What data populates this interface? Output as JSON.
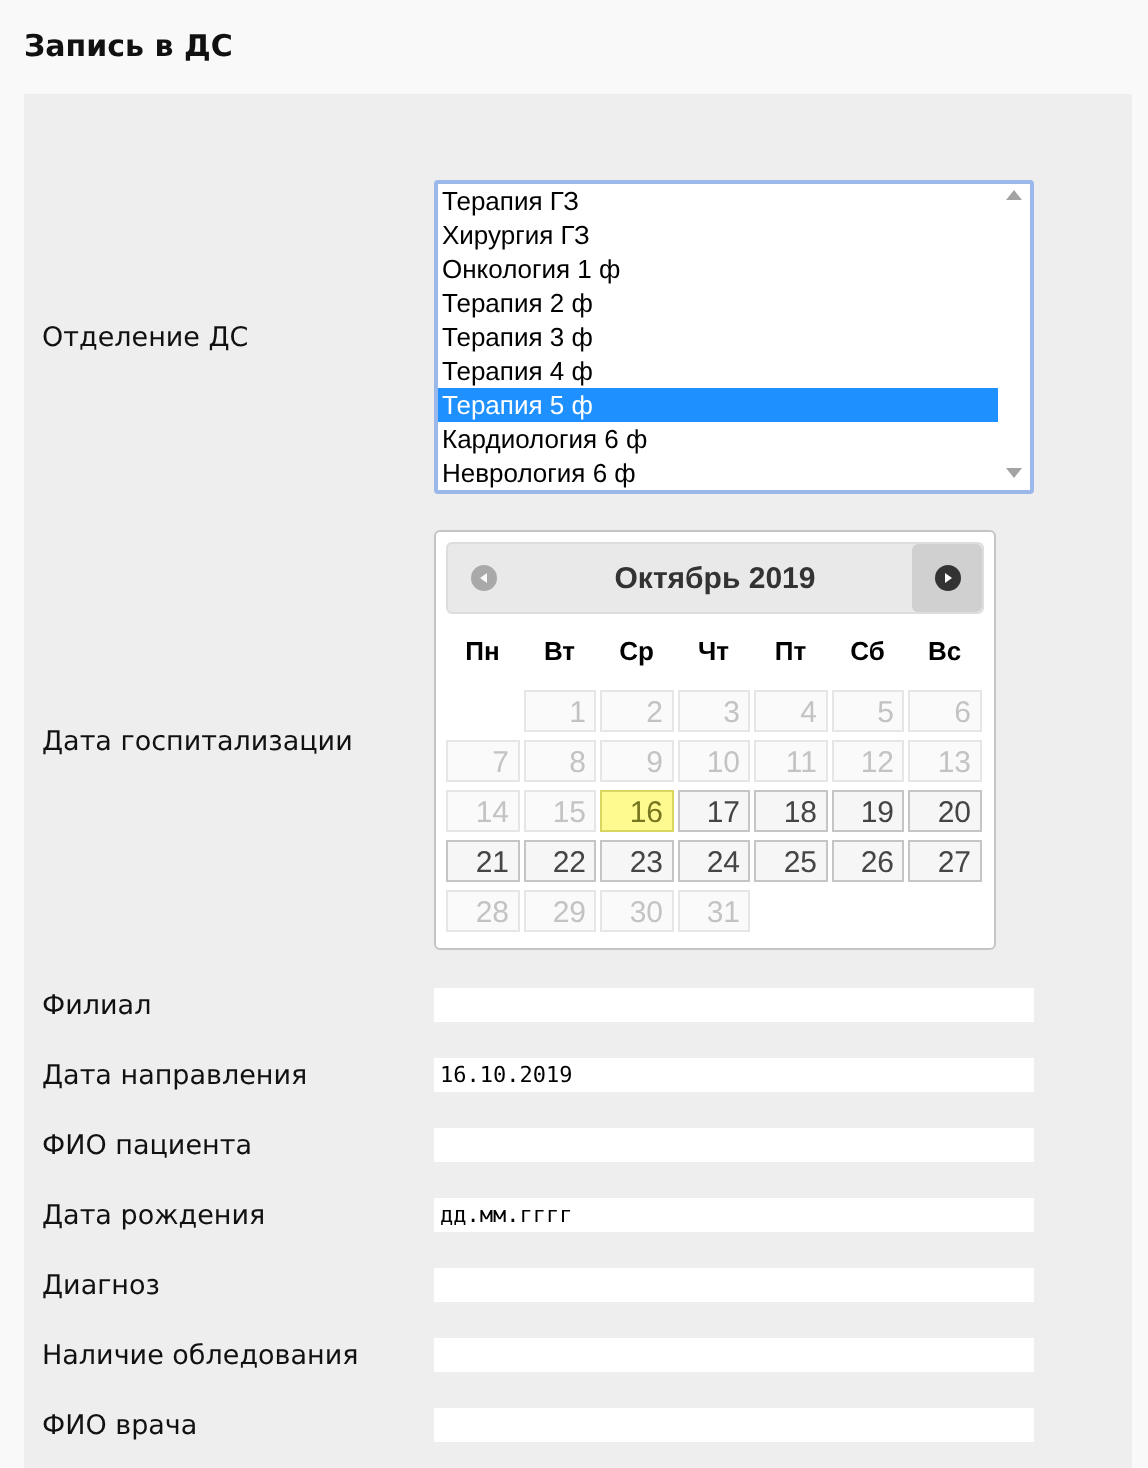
{
  "title": "Запись в ДС",
  "department": {
    "label": "Отделение ДС",
    "options": [
      {
        "label": "Терапия ГЗ",
        "selected": false
      },
      {
        "label": "Хирургия ГЗ",
        "selected": false
      },
      {
        "label": "Онкология 1 ф",
        "selected": false
      },
      {
        "label": "Терапия 2 ф",
        "selected": false
      },
      {
        "label": "Терапия 3 ф",
        "selected": false
      },
      {
        "label": "Терапия 4 ф",
        "selected": false
      },
      {
        "label": "Терапия 5 ф",
        "selected": true
      },
      {
        "label": "Кардиология 6 ф",
        "selected": false
      },
      {
        "label": "Неврология 6 ф",
        "selected": false
      }
    ]
  },
  "hospitalization": {
    "label": "Дата госпитализации",
    "calendar": {
      "month": "Октябрь 2019",
      "prev": {
        "disabled": true
      },
      "next": {
        "disabled": false
      },
      "weekdays": [
        "Пн",
        "Вт",
        "Ср",
        "Чт",
        "Пт",
        "Сб",
        "Вс"
      ],
      "weeks": [
        [
          {
            "day": "1",
            "disabled": true,
            "selected": false
          },
          {
            "day": "2",
            "disabled": true,
            "selected": false
          },
          {
            "day": "3",
            "disabled": true,
            "selected": false
          },
          {
            "day": "4",
            "disabled": true,
            "selected": false
          },
          {
            "day": "5",
            "disabled": true,
            "selected": false
          },
          {
            "day": "6",
            "disabled": true,
            "selected": false
          }
        ],
        [
          {
            "day": "7",
            "disabled": true,
            "selected": false
          },
          {
            "day": "8",
            "disabled": true,
            "selected": false
          },
          {
            "day": "9",
            "disabled": true,
            "selected": false
          },
          {
            "day": "10",
            "disabled": true,
            "selected": false
          },
          {
            "day": "11",
            "disabled": true,
            "selected": false
          },
          {
            "day": "12",
            "disabled": true,
            "selected": false
          },
          {
            "day": "13",
            "disabled": true,
            "selected": false
          }
        ],
        [
          {
            "day": "14",
            "disabled": true,
            "selected": false
          },
          {
            "day": "15",
            "disabled": true,
            "selected": false
          },
          {
            "day": "16",
            "disabled": false,
            "selected": true
          },
          {
            "day": "17",
            "disabled": false,
            "selected": false
          },
          {
            "day": "18",
            "disabled": false,
            "selected": false
          },
          {
            "day": "19",
            "disabled": false,
            "selected": false
          },
          {
            "day": "20",
            "disabled": false,
            "selected": false
          }
        ],
        [
          {
            "day": "21",
            "disabled": false,
            "selected": false
          },
          {
            "day": "22",
            "disabled": false,
            "selected": false
          },
          {
            "day": "23",
            "disabled": false,
            "selected": false
          },
          {
            "day": "24",
            "disabled": false,
            "selected": false
          },
          {
            "day": "25",
            "disabled": false,
            "selected": false
          },
          {
            "day": "26",
            "disabled": false,
            "selected": false
          },
          {
            "day": "27",
            "disabled": false,
            "selected": false
          }
        ],
        [
          {
            "day": "28",
            "disabled": true,
            "selected": false
          },
          {
            "day": "29",
            "disabled": true,
            "selected": false
          },
          {
            "day": "30",
            "disabled": true,
            "selected": false
          },
          {
            "day": "31",
            "disabled": true,
            "selected": false
          }
        ]
      ]
    }
  },
  "fields": [
    {
      "label": "Филиал"
    },
    {
      "label": "Дата направления",
      "value": "16.10.2019",
      "kind": "date"
    },
    {
      "label": "ФИО пациента"
    },
    {
      "label": "Дата рождения",
      "placeholder": "дд.мм.гггг",
      "kind": "date"
    },
    {
      "label": "Диагноз"
    },
    {
      "label": "Наличие обледования"
    },
    {
      "label": "ФИО врача"
    }
  ]
}
